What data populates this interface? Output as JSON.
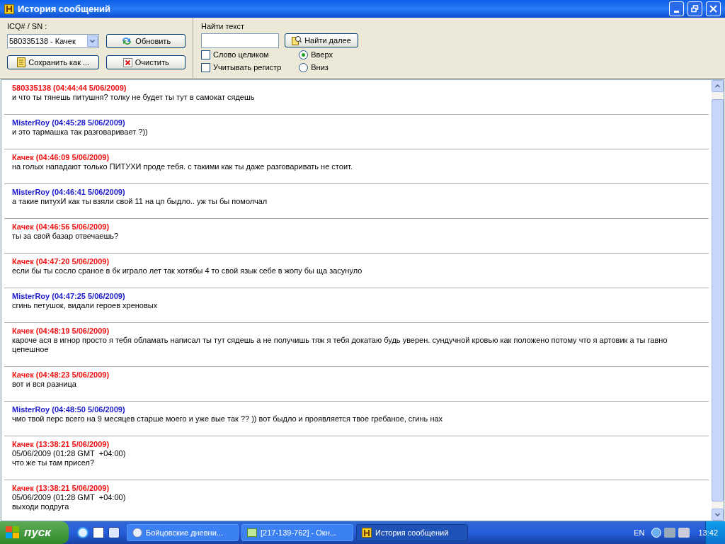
{
  "window": {
    "title": "История сообщений"
  },
  "toolbar": {
    "contact_label": "ICQ# / SN :",
    "contact_value": "580335138 - Качек",
    "refresh_button": "Обновить",
    "save_button": "Сохранить как ...",
    "clear_button": "Очистить",
    "search_label": "Найти текст",
    "find_button": "Найти далее",
    "checkboxes": [
      {
        "label": "Слово целиком",
        "checked": false
      },
      {
        "label": "Учитывать регистр",
        "checked": false
      }
    ],
    "directions": [
      {
        "label": "Вверх",
        "selected": true
      },
      {
        "label": "Вниз",
        "selected": false
      }
    ]
  },
  "messages": [
    {
      "header": "580335138 (04:44:44 5/06/2009)",
      "color": "#ee1111",
      "lines": [
        "и что ты тянешь питушня? толку не будет ты тут в самокат сядешь"
      ]
    },
    {
      "header": "MisterRoy (04:45:28 5/06/2009)",
      "color": "#1a1acc",
      "lines": [
        "и это тармашка так разговаривает ?))"
      ]
    },
    {
      "header": "Качек (04:46:09 5/06/2009)",
      "color": "#ee1111",
      "lines": [
        "на голых нападают только ПИТУХИ проде тебя. с такими как ты даже разговаривать не стоит."
      ]
    },
    {
      "header": "MisterRoy (04:46:41 5/06/2009)",
      "color": "#1a1acc",
      "lines": [
        "а такие питухИ как ты взяли свой 11 на цп быдло.. уж ты бы помолчал"
      ]
    },
    {
      "header": "Качек (04:46:56 5/06/2009)",
      "color": "#ee1111",
      "lines": [
        "ты за свой базар отвечаешь?"
      ]
    },
    {
      "header": "Качек (04:47:20 5/06/2009)",
      "color": "#ee1111",
      "lines": [
        "если бы ты сосло сраное в бк играло лет так хотябы 4 то свой язык себе в жопу бы ща засунуло"
      ]
    },
    {
      "header": "MisterRoy (04:47:25 5/06/2009)",
      "color": "#1a1acc",
      "lines": [
        "сгинь петушок, видали героев хреновых"
      ]
    },
    {
      "header": "Качек (04:48:19 5/06/2009)",
      "color": "#ee1111",
      "lines": [
        "кароче ася в игнор просто я тебя обламать написал ты тут сядешь а не получишь тяж я тебя докатаю будь уверен. сундучной кровью как положено потому что я артовик а ты гавно",
        "цепешное"
      ]
    },
    {
      "header": "Качек (04:48:23 5/06/2009)",
      "color": "#ee1111",
      "lines": [
        "вот и вся разница"
      ]
    },
    {
      "header": "MisterRoy (04:48:50 5/06/2009)",
      "color": "#1a1acc",
      "lines": [
        "чмо твой перс всего на 9 месяцев старше моего и уже вые так ?? )) вот быдло и проявляется твое гребаное, сгинь нах"
      ]
    },
    {
      "header": "Качек (13:38:21 5/06/2009)",
      "color": "#ee1111",
      "lines": [
        "05/06/2009 (01:28 GMT  +04:00)",
        "что же ты там присел?"
      ]
    },
    {
      "header": "Качек (13:38:21 5/06/2009)",
      "color": "#ee1111",
      "lines": [
        "05/06/2009 (01:28 GMT  +04:00)",
        "выходи подруга"
      ]
    }
  ],
  "taskbar": {
    "start": "пуск",
    "tasks": [
      {
        "label": "Бойцовские дневни...",
        "kind": "globe",
        "selected": false
      },
      {
        "label": "[217-139-762] - Окн...",
        "kind": "chat",
        "selected": false
      },
      {
        "label": "История сообщений",
        "kind": "history",
        "selected": true
      }
    ],
    "language": "EN",
    "clock": "13:42"
  }
}
